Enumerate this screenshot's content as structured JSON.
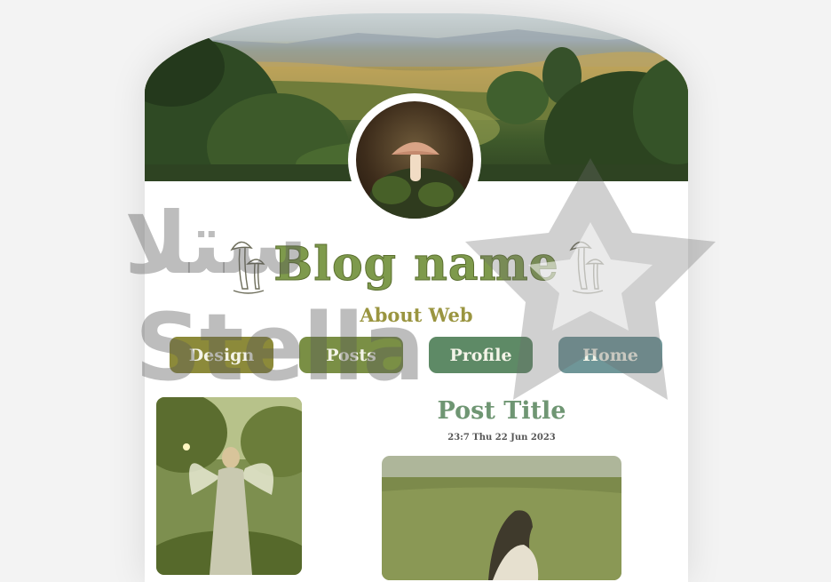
{
  "blog": {
    "name": "Blog name",
    "subtitle": "About Web"
  },
  "nav": {
    "items": [
      {
        "label": "Design",
        "color": "#8c8a3a"
      },
      {
        "label": "Posts",
        "color": "#7a8f45"
      },
      {
        "label": "Profile",
        "color": "#5e8a66"
      },
      {
        "label": "Home",
        "color": "#6f9698"
      }
    ]
  },
  "post": {
    "title": "Post Title",
    "date": "23:7 Thu 22 Jun 2023"
  },
  "watermark": {
    "latin": "Stella",
    "arabic": "ستلا"
  },
  "colors": {
    "blog_name": "#7e9a4c",
    "subtitle": "#9a9540",
    "post_title": "#6f9673",
    "page_bg": "#f3f3f3"
  },
  "icons": {
    "title_decoration": "mushroom-icon",
    "watermark_shape": "star-icon"
  }
}
